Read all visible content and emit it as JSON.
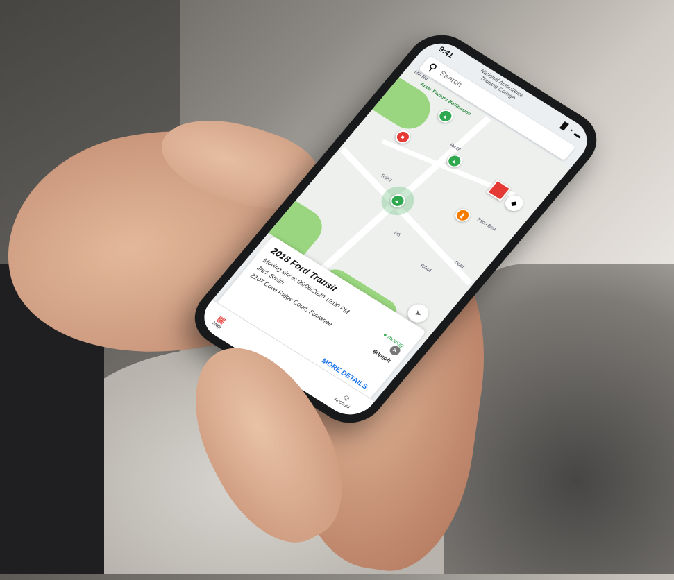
{
  "status_bar": {
    "time": "9:41",
    "signal": "▉",
    "wifi": "◔",
    "battery": "▬"
  },
  "map_header": {
    "location_line1": "National Ambulance",
    "location_line2": "Training College"
  },
  "search": {
    "placeholder": "Search"
  },
  "map": {
    "labels": {
      "poi": "Aptar Factory Ballinasloe",
      "street_top": "Mill Rd",
      "street_east": "Bijou Bea",
      "dublin": "Dubl",
      "road_r446": "R446",
      "road_r357": "R357",
      "road_n6": "N6",
      "road_r444": "R444"
    },
    "colors": {
      "park": "#9ad67f",
      "moving": "#2fa84f",
      "stopped": "#e53935",
      "idle": "#f57c00"
    }
  },
  "vehicle_card": {
    "title": "2018 Ford Transit",
    "status": "moving",
    "moving_since": "Moving since: 05/06/2020 19:00 PM",
    "driver": "Jack Smith",
    "address": "2107 Cove Ridge Court, Suwanee",
    "speed": "60mph",
    "more_details": "MORE DETAILS"
  },
  "tabbar": {
    "map_label": "Map",
    "account_label": "Account"
  }
}
